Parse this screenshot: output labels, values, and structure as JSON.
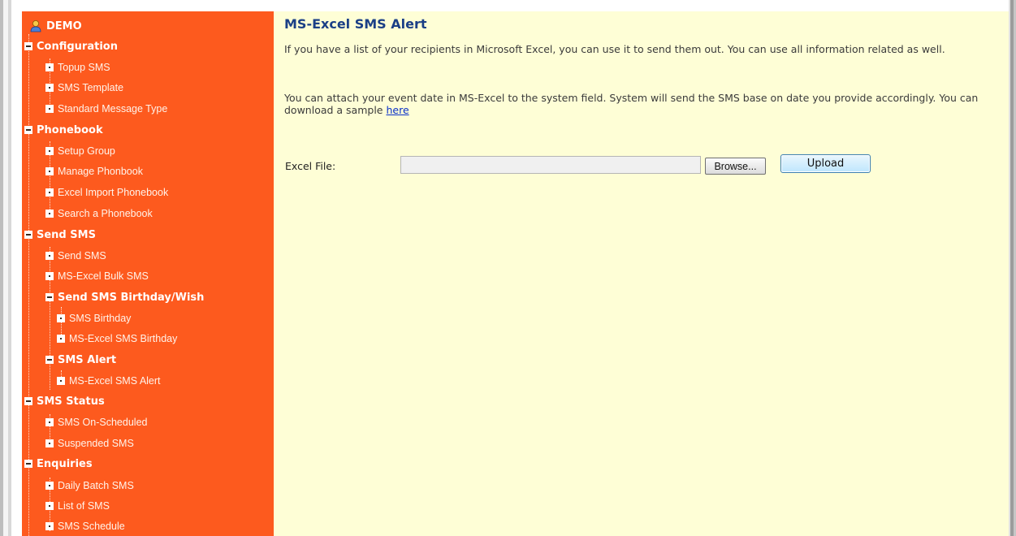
{
  "sidebar": {
    "root": "DEMO",
    "configuration": {
      "label": "Configuration",
      "items": [
        "Topup SMS",
        "SMS Template",
        "Standard Message Type"
      ]
    },
    "phonebook": {
      "label": "Phonebook",
      "items": [
        "Setup Group",
        "Manage Phonbook",
        "Excel Import Phonebook",
        "Search a Phonebook"
      ]
    },
    "send_sms": {
      "label": "Send SMS",
      "items": [
        "Send SMS",
        "MS-Excel Bulk SMS"
      ],
      "birthday": {
        "label": "Send SMS Birthday/Wish",
        "items": [
          "SMS Birthday",
          "MS-Excel SMS Birthday"
        ]
      },
      "alert": {
        "label": "SMS Alert",
        "items": [
          "MS-Excel SMS Alert"
        ]
      }
    },
    "sms_status": {
      "label": "SMS Status",
      "items": [
        "SMS On-Scheduled",
        "Suspended SMS"
      ]
    },
    "enquiries": {
      "label": "Enquiries",
      "items": [
        "Daily Batch SMS",
        "List of SMS",
        "SMS Schedule"
      ]
    }
  },
  "main": {
    "title": "MS-Excel SMS Alert",
    "intro": "If you have a list of your recipients in Microsoft Excel, you can use it to send them out. You can use all information related as well.",
    "attach_text": "You can attach your event date in MS-Excel to the system field. System will send the SMS base on date you provide accordingly. You can download a sample",
    "link_text": "here",
    "file_label": "Excel File:",
    "file_value": "",
    "browse_label": "Browse...",
    "upload_label": "Upload"
  },
  "colors": {
    "sidebar_bg": "#fd5a1e",
    "content_bg": "#fefed6",
    "title": "#1b3f86",
    "link": "#0a31c8"
  }
}
